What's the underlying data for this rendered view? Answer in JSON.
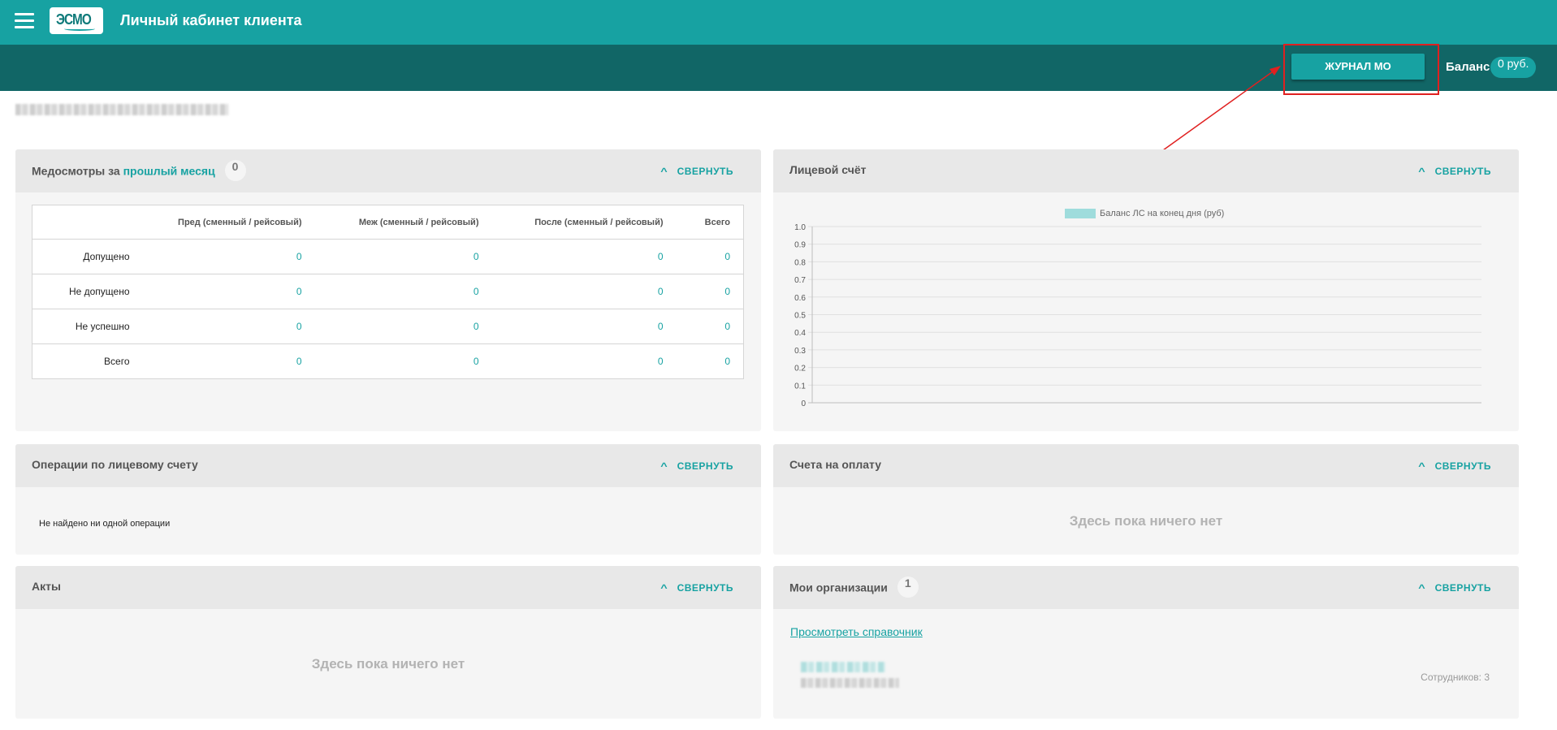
{
  "header": {
    "title": "Личный кабинет клиента",
    "logo_text": "ЭСМО",
    "menu_icon": "hamburger-icon"
  },
  "subheader": {
    "journal_button": "ЖУРНАЛ МО",
    "balance_label": "Баланс:",
    "balance_value": "0 руб."
  },
  "colors": {
    "primary": "#17a2a2",
    "primary_dark": "#116666",
    "annotation": "#e02020"
  },
  "collapse_label": "СВЕРНУТЬ",
  "medchecks": {
    "title_prefix": "Медосмотры за",
    "title_accent": "прошлый месяц",
    "count": "0",
    "columns": [
      "",
      "Пред (сменный / рейсовый)",
      "Меж (сменный / рейсовый)",
      "После (сменный / рейсовый)",
      "Всего"
    ],
    "rows": [
      {
        "label": "Допущено",
        "values": [
          "0",
          "0",
          "0",
          "0"
        ]
      },
      {
        "label": "Не допущено",
        "values": [
          "0",
          "0",
          "0",
          "0"
        ]
      },
      {
        "label": "Не успешно",
        "values": [
          "0",
          "0",
          "0",
          "0"
        ]
      },
      {
        "label": "Всего",
        "values": [
          "0",
          "0",
          "0",
          "0"
        ]
      }
    ]
  },
  "account": {
    "title": "Лицевой счёт"
  },
  "chart_data": {
    "type": "line",
    "title": "",
    "series": [
      {
        "name": "Баланс ЛС на конец дня (руб)",
        "values": []
      }
    ],
    "y_ticks": [
      "1.0",
      "0.9",
      "0.8",
      "0.7",
      "0.6",
      "0.5",
      "0.4",
      "0.3",
      "0.2",
      "0.1",
      "0"
    ],
    "ylim": [
      0,
      1.0
    ],
    "grid": true,
    "legend": "top-center"
  },
  "operations": {
    "title": "Операции по лицевому счету",
    "empty": "Не найдено ни одной операции"
  },
  "invoices": {
    "title": "Счета на оплату",
    "empty": "Здесь пока ничего нет"
  },
  "acts": {
    "title": "Акты",
    "empty": "Здесь пока ничего нет"
  },
  "orgs": {
    "title": "Мои организации",
    "count": "1",
    "link": "Просмотреть справочник",
    "employees": "Сотрудников: 3"
  }
}
